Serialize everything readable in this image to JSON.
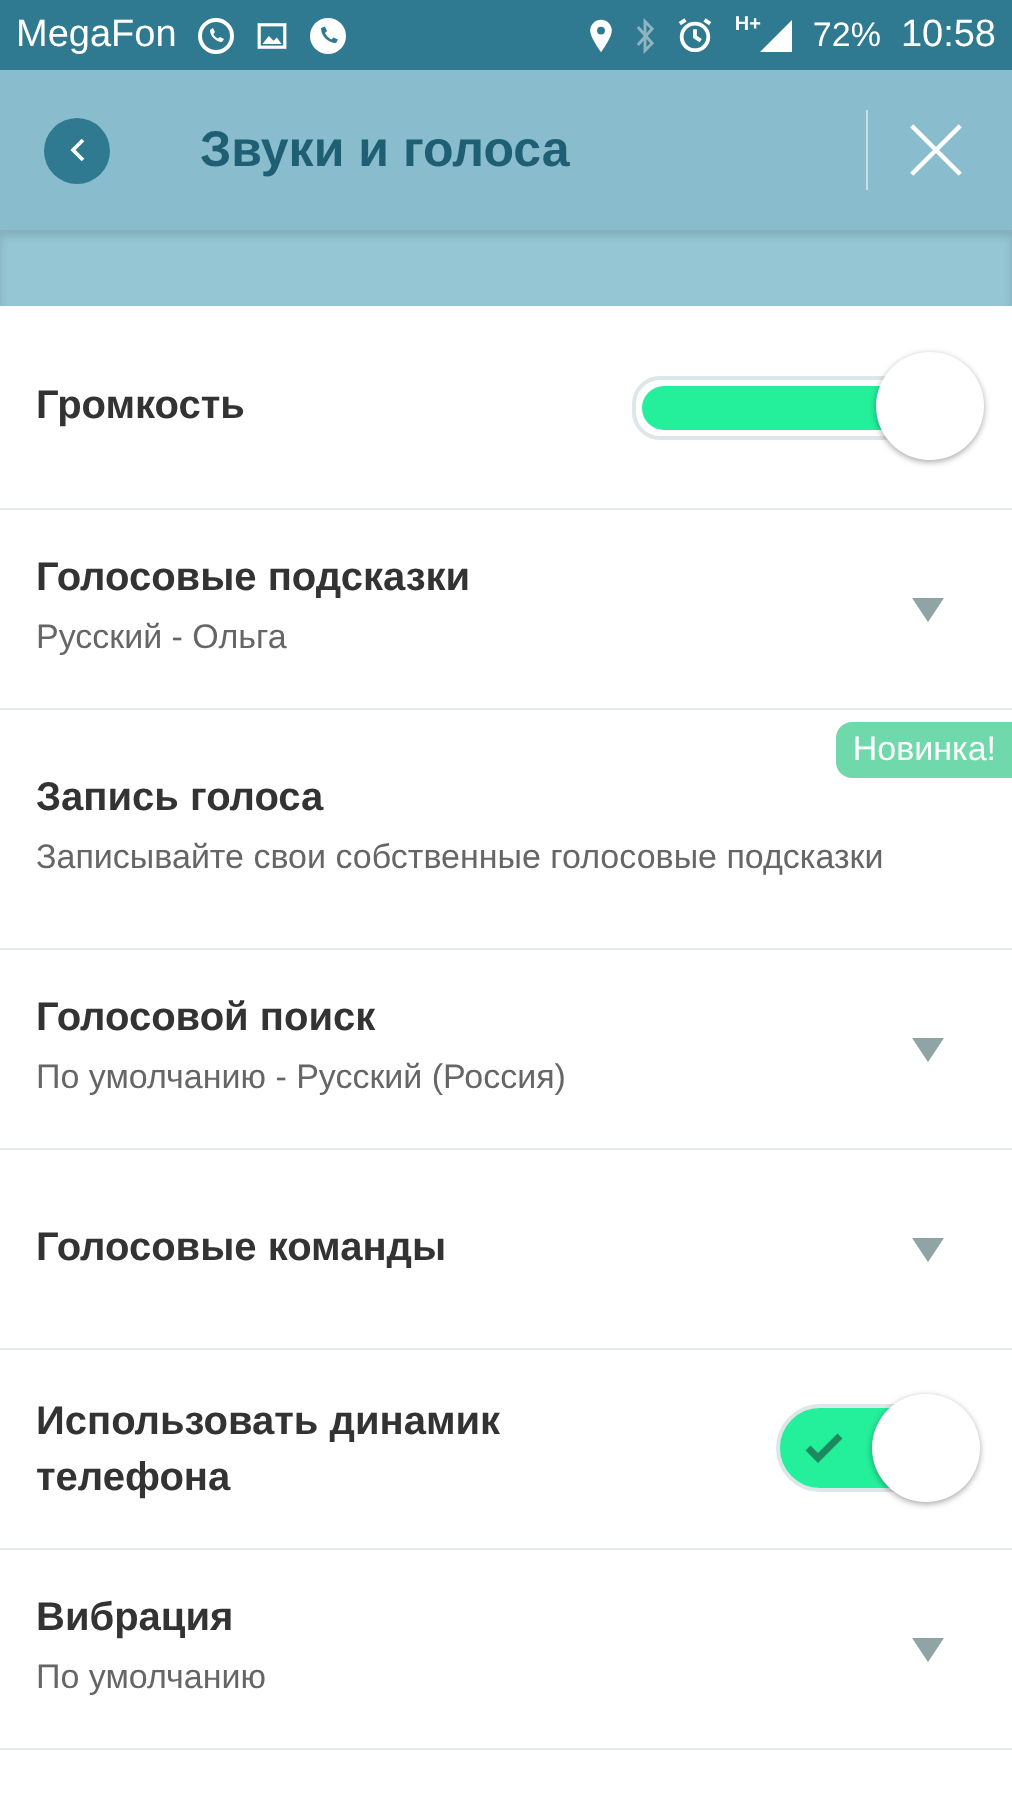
{
  "status_bar": {
    "carrier": "MegaFon",
    "network": "H+",
    "battery": "72%",
    "time": "10:58"
  },
  "header": {
    "title": "Звуки и голоса"
  },
  "settings": [
    {
      "kind": "slider",
      "title": "Громкость",
      "level": 1
    },
    {
      "kind": "dropdown",
      "title": "Голосовые подсказки",
      "subtitle": "Русский - Ольга"
    },
    {
      "kind": "badge",
      "title": "Запись голоса",
      "subtitle": "Записывайте свои собственные голосовые подсказки",
      "badge": "Новинка!"
    },
    {
      "kind": "dropdown",
      "title": "Голосовой поиск",
      "subtitle": "По умолчанию - Русский (Россия)"
    },
    {
      "kind": "dropdown",
      "title": "Голосовые команды"
    },
    {
      "kind": "toggle",
      "title": "Использовать динамик телефона",
      "on": true
    },
    {
      "kind": "dropdown",
      "title": "Вибрация",
      "subtitle": "По умолчанию"
    }
  ]
}
